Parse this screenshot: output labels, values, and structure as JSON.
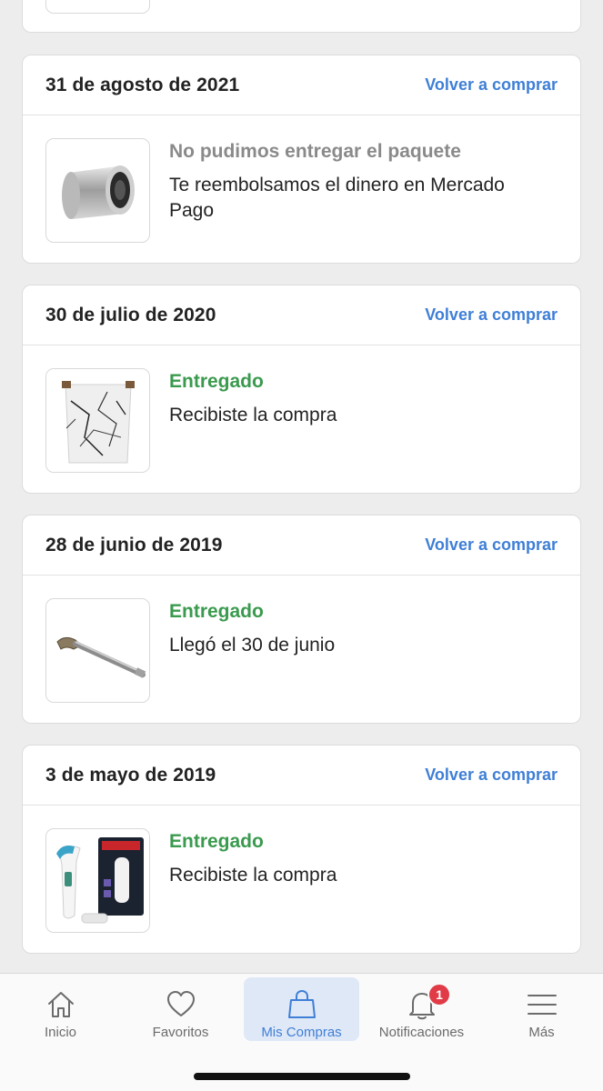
{
  "orders": [
    {
      "date": "31 de agosto de 2021",
      "rebuy_label": "Volver a comprar",
      "status": "No pudimos entregar el paquete",
      "status_color": "#8a8a8a",
      "description": "Te reembolsamos el dinero en Mercado Pago",
      "product_icon": "bearing-image"
    },
    {
      "date": "30 de julio de 2020",
      "rebuy_label": "Volver a comprar",
      "status": "Entregado",
      "status_color": "#3a9a4e",
      "description": "Recibiste la compra",
      "product_icon": "marble-basket-image"
    },
    {
      "date": "28 de junio de 2019",
      "rebuy_label": "Volver a comprar",
      "status": "Entregado",
      "status_color": "#3a9a4e",
      "description": "Llegó el 30 de junio",
      "product_icon": "metal-rod-image"
    },
    {
      "date": "3 de mayo de 2019",
      "rebuy_label": "Volver a comprar",
      "status": "Entregado",
      "status_color": "#3a9a4e",
      "description": "Recibiste la compra",
      "product_icon": "ear-thermometer-image"
    }
  ],
  "tabbar": {
    "tabs": [
      {
        "label": "Inicio",
        "icon": "home-icon",
        "active": false
      },
      {
        "label": "Favoritos",
        "icon": "heart-icon",
        "active": false
      },
      {
        "label": "Mis Compras",
        "icon": "shopping-bag-icon",
        "active": true
      },
      {
        "label": "Notificaciones",
        "icon": "bell-icon",
        "active": false,
        "badge": "1"
      },
      {
        "label": "Más",
        "icon": "menu-icon",
        "active": false
      }
    ]
  },
  "colors": {
    "accent": "#3f7fd6",
    "delivered": "#3a9a4e",
    "failed": "#8a8a8a",
    "badge": "#e03b46"
  }
}
